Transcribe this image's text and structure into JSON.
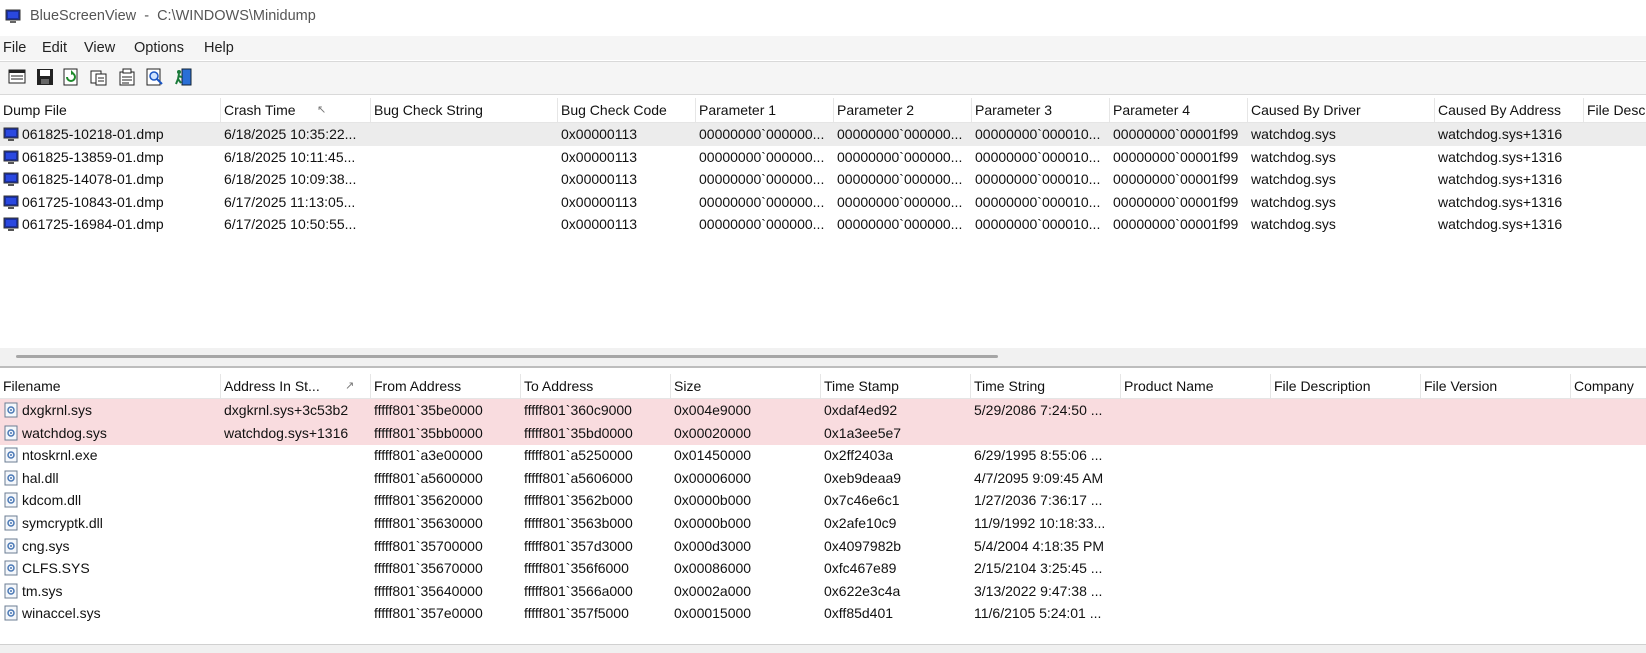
{
  "window": {
    "title": "BlueScreenView  -  C:\\WINDOWS\\Minidump"
  },
  "menu": [
    "File",
    "Edit",
    "View",
    "Options",
    "Help"
  ],
  "toolbar": {
    "buttons": [
      {
        "name": "html-report-icon"
      },
      {
        "name": "save-icon"
      },
      {
        "name": "refresh-icon"
      },
      {
        "name": "copy-icon"
      },
      {
        "name": "properties-icon"
      },
      {
        "name": "find-icon"
      },
      {
        "name": "exit-icon"
      }
    ]
  },
  "dump_table": {
    "columns": [
      "Dump File",
      "Crash Time",
      "Bug Check String",
      "Bug Check Code",
      "Parameter 1",
      "Parameter 2",
      "Parameter 3",
      "Parameter 4",
      "Caused By Driver",
      "Caused By Address",
      "File Desc"
    ],
    "sorted_column": "Crash Time",
    "rows": [
      [
        "061825-10218-01.dmp",
        "6/18/2025 10:35:22...",
        "",
        "0x00000113",
        "00000000`000000...",
        "00000000`000000...",
        "00000000`000010...",
        "00000000`00001f99",
        "watchdog.sys",
        "watchdog.sys+1316",
        ""
      ],
      [
        "061825-13859-01.dmp",
        "6/18/2025 10:11:45...",
        "",
        "0x00000113",
        "00000000`000000...",
        "00000000`000000...",
        "00000000`000010...",
        "00000000`00001f99",
        "watchdog.sys",
        "watchdog.sys+1316",
        ""
      ],
      [
        "061825-14078-01.dmp",
        "6/18/2025 10:09:38...",
        "",
        "0x00000113",
        "00000000`000000...",
        "00000000`000000...",
        "00000000`000010...",
        "00000000`00001f99",
        "watchdog.sys",
        "watchdog.sys+1316",
        ""
      ],
      [
        "061725-10843-01.dmp",
        "6/17/2025 11:13:05...",
        "",
        "0x00000113",
        "00000000`000000...",
        "00000000`000000...",
        "00000000`000010...",
        "00000000`00001f99",
        "watchdog.sys",
        "watchdog.sys+1316",
        ""
      ],
      [
        "061725-16984-01.dmp",
        "6/17/2025 10:50:55...",
        "",
        "0x00000113",
        "00000000`000000...",
        "00000000`000000...",
        "00000000`000010...",
        "00000000`00001f99",
        "watchdog.sys",
        "watchdog.sys+1316",
        ""
      ]
    ],
    "selected_row": 0
  },
  "driver_table": {
    "columns": [
      "Filename",
      "Address In St...",
      "From Address",
      "To Address",
      "Size",
      "Time Stamp",
      "Time String",
      "Product Name",
      "File Description",
      "File Version",
      "Company"
    ],
    "sorted_column": "Address In St...",
    "highlighted_rows": [
      0,
      1
    ],
    "rows": [
      [
        "dxgkrnl.sys",
        "dxgkrnl.sys+3c53b2",
        "fffff801`35be0000",
        "fffff801`360c9000",
        "0x004e9000",
        "0xdaf4ed92",
        "5/29/2086 7:24:50 ...",
        "",
        "",
        "",
        ""
      ],
      [
        "watchdog.sys",
        "watchdog.sys+1316",
        "fffff801`35bb0000",
        "fffff801`35bd0000",
        "0x00020000",
        "0x1a3ee5e7",
        "",
        "",
        "",
        "",
        ""
      ],
      [
        "ntoskrnl.exe",
        "",
        "fffff801`a3e00000",
        "fffff801`a5250000",
        "0x01450000",
        "0x2ff2403a",
        "6/29/1995 8:55:06 ...",
        "",
        "",
        "",
        ""
      ],
      [
        "hal.dll",
        "",
        "fffff801`a5600000",
        "fffff801`a5606000",
        "0x00006000",
        "0xeb9deaa9",
        "4/7/2095 9:09:45 AM",
        "",
        "",
        "",
        ""
      ],
      [
        "kdcom.dll",
        "",
        "fffff801`35620000",
        "fffff801`3562b000",
        "0x0000b000",
        "0x7c46e6c1",
        "1/27/2036 7:36:17 ...",
        "",
        "",
        "",
        ""
      ],
      [
        "symcryptk.dll",
        "",
        "fffff801`35630000",
        "fffff801`3563b000",
        "0x0000b000",
        "0x2afe10c9",
        "11/9/1992 10:18:33...",
        "",
        "",
        "",
        ""
      ],
      [
        "cng.sys",
        "",
        "fffff801`35700000",
        "fffff801`357d3000",
        "0x000d3000",
        "0x4097982b",
        "5/4/2004 4:18:35 PM",
        "",
        "",
        "",
        ""
      ],
      [
        "CLFS.SYS",
        "",
        "fffff801`35670000",
        "fffff801`356f6000",
        "0x00086000",
        "0xfc467e89",
        "2/15/2104 3:25:45 ...",
        "",
        "",
        "",
        ""
      ],
      [
        "tm.sys",
        "",
        "fffff801`35640000",
        "fffff801`3566a000",
        "0x0002a000",
        "0x622e3c4a",
        "3/13/2022 9:47:38 ...",
        "",
        "",
        "",
        ""
      ],
      [
        "winaccel.sys",
        "",
        "fffff801`357e0000",
        "fffff801`357f5000",
        "0x00015000",
        "0xff85d401",
        "11/6/2105 5:24:01 ...",
        "",
        "",
        "",
        ""
      ]
    ]
  },
  "colors": {
    "selected_row_bg": "#ececec",
    "highlight_row_bg": "#f9dcdf",
    "menubar_bg": "#f5f5f5"
  }
}
